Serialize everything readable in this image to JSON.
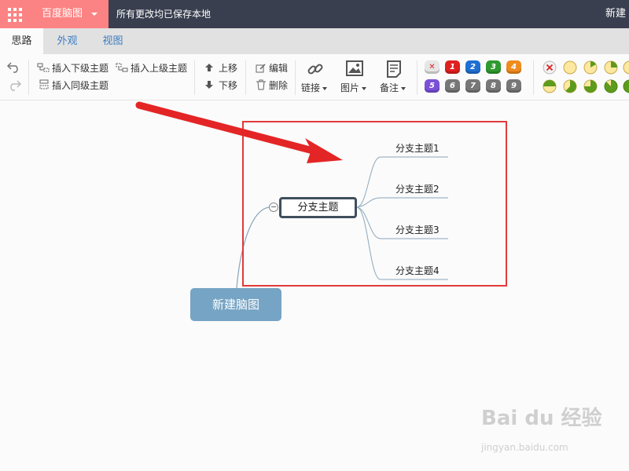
{
  "topbar": {
    "brand": "百度脑图",
    "save_status": "所有更改均已保存本地",
    "newdoc": "新建"
  },
  "tabs": [
    {
      "label": "思路",
      "active": true
    },
    {
      "label": "外观",
      "active": false
    },
    {
      "label": "视图",
      "active": false
    }
  ],
  "toolbar": {
    "insert_child": "插入下级主题",
    "insert_parent": "插入上级主题",
    "insert_sibling": "插入同级主题",
    "move_up": "上移",
    "move_down": "下移",
    "edit": "编辑",
    "delete": "删除",
    "link": "链接",
    "image": "图片",
    "note": "备注",
    "priority_numbers": [
      "1",
      "2",
      "3",
      "4",
      "5",
      "6",
      "7",
      "8",
      "9"
    ],
    "priority_colors": [
      "#e02020",
      "#1f6fd3",
      "#2f9a2f",
      "#f08b1e",
      "#7b4fd8",
      "#777777",
      "#777777",
      "#777777",
      "#777777"
    ]
  },
  "mindmap": {
    "root": "新建脑图",
    "main": "分支主题",
    "branches": [
      "分支主题1",
      "分支主题2",
      "分支主题3",
      "分支主题4"
    ]
  },
  "watermark": {
    "main": "Bai du 经验",
    "sub": "jingyan.baidu.com"
  }
}
